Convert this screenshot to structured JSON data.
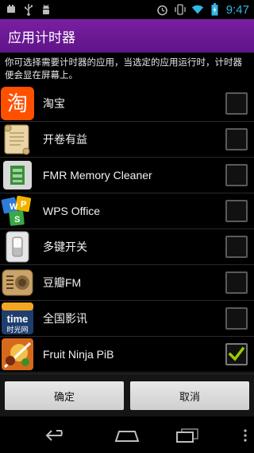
{
  "status_bar": {
    "time": "9:47",
    "left_icons": [
      "android-notification-icon",
      "usb-icon",
      "android-debug-icon"
    ],
    "right_icons": [
      "alarm-icon",
      "vibrate-icon",
      "wifi-icon",
      "battery-icon"
    ],
    "accent": "#33b5e5"
  },
  "title_bar": {
    "title": "应用计时器",
    "color": "#6a1b9a"
  },
  "description": "你可选择需要计时器的应用，当选定的应用运行时，计时器便会显在屏幕上。",
  "apps": [
    {
      "label": "淘宝",
      "icon": "taobao-icon",
      "checked": false
    },
    {
      "label": "开卷有益",
      "icon": "scroll-book-icon",
      "checked": false
    },
    {
      "label": "FMR Memory Cleaner",
      "icon": "memory-cleaner-icon",
      "checked": false
    },
    {
      "label": "WPS Office",
      "icon": "wps-office-icon",
      "checked": false
    },
    {
      "label": "多键开关",
      "icon": "switch-icon",
      "checked": false
    },
    {
      "label": "豆瓣FM",
      "icon": "radio-icon",
      "checked": false
    },
    {
      "label": "全国影讯",
      "icon": "mtime-icon",
      "checked": false
    },
    {
      "label": "Fruit Ninja PiB",
      "icon": "fruit-ninja-icon",
      "checked": true
    }
  ],
  "buttons": {
    "ok": "确定",
    "cancel": "取消"
  },
  "nav": {
    "icons": [
      "back-icon",
      "home-icon",
      "recents-icon",
      "overflow-menu-icon"
    ]
  },
  "mtime_icon_text": {
    "top": "time",
    "bottom": "时光网"
  },
  "taobao_icon_text": "淘"
}
